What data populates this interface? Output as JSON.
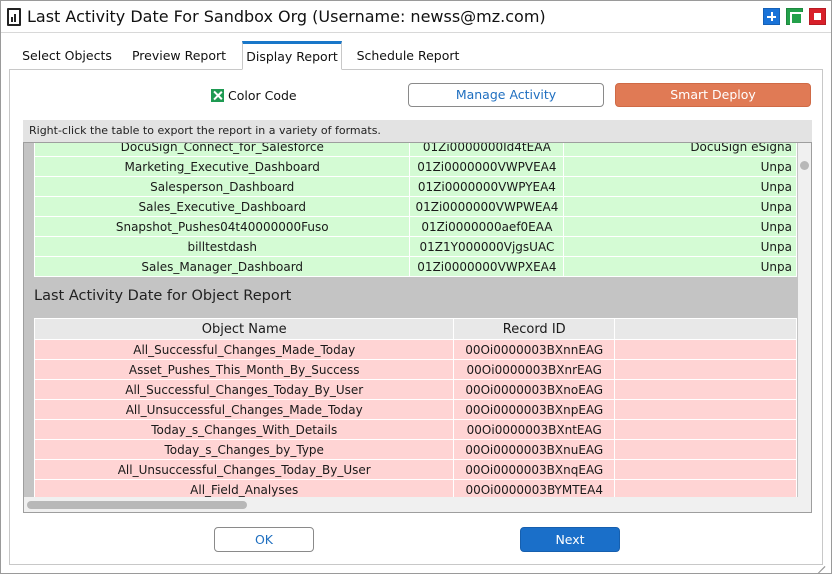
{
  "window": {
    "title": "Last Activity Date For Sandbox Org (Username: newss@mz.com)",
    "icon": "report-icon",
    "controls": [
      "maximize-icon",
      "restore-icon",
      "close-icon"
    ],
    "colors": {
      "maximize": "#1a73d8",
      "restore": "#23a04a",
      "close": "#d8202a"
    }
  },
  "tabs": [
    {
      "label": "Select Objects",
      "active": false
    },
    {
      "label": "Preview Report",
      "active": false
    },
    {
      "label": "Display Report",
      "active": true
    },
    {
      "label": "Schedule Report",
      "active": false
    }
  ],
  "toolbar": {
    "color_code_label": "Color Code",
    "color_code_checked": true,
    "manage_activity_label": "Manage Activity",
    "smart_deploy_label": "Smart Deploy"
  },
  "hint": "Right-click the table to export the report in a variety of formats.",
  "dashboard_table": {
    "row_color": "#d4fbd4",
    "rows": [
      [
        "DocuSign_Connect_for_Salesforce",
        "01Zi0000000Id4tEAA",
        "DocuSign eSigna"
      ],
      [
        "Marketing_Executive_Dashboard",
        "01Zi0000000VWPVEA4",
        "Unpa"
      ],
      [
        "Salesperson_Dashboard",
        "01Zi0000000VWPYEA4",
        "Unpa"
      ],
      [
        "Sales_Executive_Dashboard",
        "01Zi0000000VWPWEA4",
        "Unpa"
      ],
      [
        "Snapshot_Pushes04t40000000Fuso",
        "01Zi0000000aef0EAA",
        "Unpa"
      ],
      [
        "billtestdash",
        "01Z1Y000000VjgsUAC",
        "Unpa"
      ],
      [
        "Sales_Manager_Dashboard",
        "01Zi0000000VWPXEA4",
        "Unpa"
      ]
    ]
  },
  "object_report": {
    "title": "Last Activity Date for Object Report",
    "row_color": "#ffd4d4",
    "columns": [
      "Object Name",
      "Record ID",
      ""
    ],
    "rows": [
      [
        "All_Successful_Changes_Made_Today",
        "00Oi0000003BXnnEAG",
        ""
      ],
      [
        "Asset_Pushes_This_Month_By_Success",
        "00Oi0000003BXnrEAG",
        ""
      ],
      [
        "All_Successful_Changes_Today_By_User",
        "00Oi0000003BXnoEAG",
        ""
      ],
      [
        "All_Unsuccessful_Changes_Made_Today",
        "00Oi0000003BXnpEAG",
        ""
      ],
      [
        "Today_s_Changes_With_Details",
        "00Oi0000003BXntEAG",
        ""
      ],
      [
        "Today_s_Changes_by_Type",
        "00Oi0000003BXnuEAG",
        ""
      ],
      [
        "All_Unsuccessful_Changes_Today_By_User",
        "00Oi0000003BXnqEAG",
        ""
      ],
      [
        "All_Field_Analyses",
        "00Oi0000003BYMTEA4",
        ""
      ]
    ]
  },
  "footer": {
    "ok_label": "OK",
    "next_label": "Next"
  }
}
